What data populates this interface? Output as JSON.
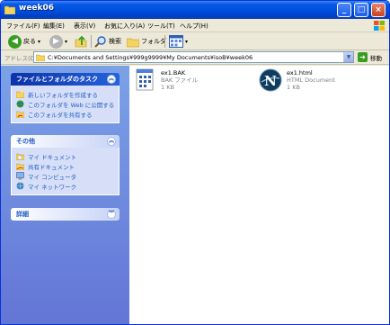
{
  "window": {
    "title": "week06",
    "controls": {
      "minimize": "_",
      "maximize": "□",
      "close": "×"
    }
  },
  "menubar": {
    "items": [
      "ファイル(F)",
      "編集(E)",
      "表示(V)",
      "お気に入り(A)",
      "ツール(T)",
      "ヘルプ(H)"
    ]
  },
  "toolbar": {
    "back_label": "戻る",
    "search_label": "検索",
    "folders_label": "フォルダ"
  },
  "address": {
    "label": "アドレス(D)",
    "value": "C:¥Documents and Settings¥999g9999¥My Documents¥isoB¥week06",
    "go_label": "移動"
  },
  "tasks_panel": {
    "title": "ファイルとフォルダのタスク",
    "items": [
      {
        "label": "新しいフォルダを作成する",
        "icon": "new-folder-icon"
      },
      {
        "label": "このフォルダを Web に公開する",
        "icon": "web-publish-icon"
      },
      {
        "label": "このフォルダを共有する",
        "icon": "share-folder-icon"
      }
    ]
  },
  "places_panel": {
    "title": "その他",
    "items": [
      {
        "label": "マイ ドキュメント",
        "icon": "my-documents-icon"
      },
      {
        "label": "共有ドキュメント",
        "icon": "shared-documents-icon"
      },
      {
        "label": "マイ コンピュータ",
        "icon": "my-computer-icon"
      },
      {
        "label": "マイ ネットワーク",
        "icon": "my-network-icon"
      }
    ]
  },
  "details_panel": {
    "title": "詳細"
  },
  "files": [
    {
      "name": "ex1.BAK",
      "type": "BAK ファイル",
      "size": "1 KB",
      "icon": "bak-file-icon"
    },
    {
      "name": "ex1.html",
      "type": "HTML Document",
      "size": "1 KB",
      "icon": "netscape-html-icon"
    }
  ],
  "colors": {
    "titlebar": "#0050e0",
    "taskpane": "#6f8fe0",
    "link": "#215dc6"
  }
}
